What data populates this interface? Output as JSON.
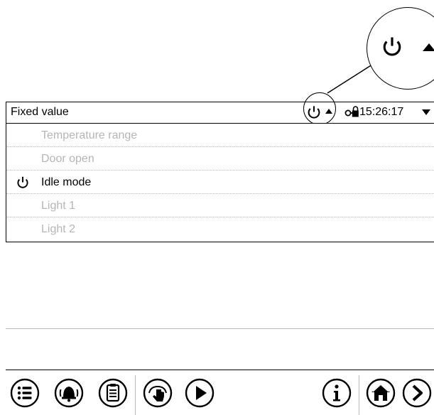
{
  "header": {
    "title": "Fixed value",
    "time": "15:26:17",
    "icons": [
      "power-icon",
      "up-arrow-icon",
      "key-lock-icon",
      "dropdown-arrow-icon"
    ]
  },
  "list": {
    "items": [
      {
        "label": "Temperature range",
        "enabled": false,
        "icon": ""
      },
      {
        "label": "Door open",
        "enabled": false,
        "icon": ""
      },
      {
        "label": "Idle mode",
        "enabled": true,
        "icon": "power-icon"
      },
      {
        "label": "Light 1",
        "enabled": false,
        "icon": ""
      },
      {
        "label": "Light 2",
        "enabled": false,
        "icon": ""
      }
    ]
  },
  "toolbar": {
    "buttons": [
      "menu-list-icon",
      "alarm-bell-icon",
      "clipboard-icon",
      "manual-touch-icon",
      "play-icon",
      "info-icon",
      "home-icon",
      "next-arrow-icon"
    ]
  },
  "callout": {
    "icons": [
      "power-icon",
      "up-arrow-icon"
    ]
  }
}
